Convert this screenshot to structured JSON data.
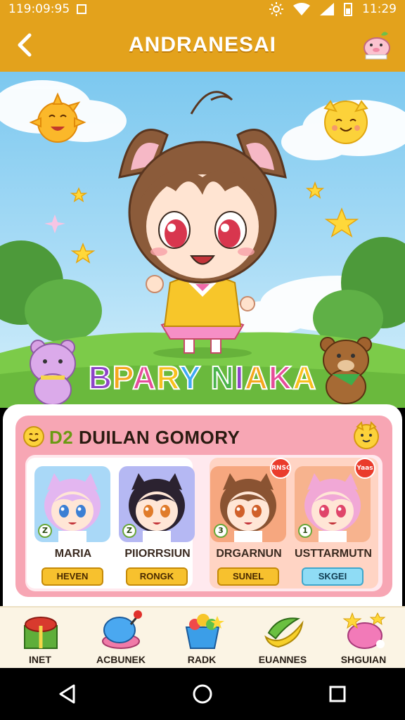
{
  "status_bar": {
    "time_left": "119:09:95",
    "time_right": "11:29"
  },
  "app_bar": {
    "title": "ANDRANESAI"
  },
  "hero": {
    "banner_text": "BPARY NIAKA",
    "banner_colors": [
      "#8e44c8",
      "#f4a81d",
      "#e54d9a",
      "#f7c11e",
      "#3fa9f5",
      "#4bb44b"
    ]
  },
  "party": {
    "level": "D2",
    "title": "DUILAN GOMORY",
    "characters": [
      {
        "name": "MARIA",
        "tag": "HEVEN",
        "level": "Z",
        "badge": "",
        "bg": "#a9d8f7",
        "hair": "#e3b6f0",
        "eyes": "#3b7fd4",
        "tag_style": "gold"
      },
      {
        "name": "PIIORRSIUN",
        "tag": "RONGK",
        "level": "Z",
        "badge": "",
        "bg": "#b5b8f3",
        "hair": "#2b2230",
        "eyes": "#e07b2a",
        "tag_style": "gold"
      },
      {
        "name": "DRGARNUN",
        "tag": "SUNEL",
        "level": "3",
        "badge": "RNSG",
        "bg": "#f6a77f",
        "hair": "#8a5332",
        "eyes": "#d0602a",
        "tag_style": "gold"
      },
      {
        "name": "USTTARMUTN",
        "tag": "SKGEI",
        "level": "1",
        "badge": "Yaas",
        "bg": "#f7b38e",
        "hair": "#f1a8d6",
        "eyes": "#e0456a",
        "tag_style": "blue"
      }
    ]
  },
  "bottom_nav": [
    {
      "label": "INET",
      "icon": "gift-basket-icon"
    },
    {
      "label": "ACBUNEK",
      "icon": "joystick-icon"
    },
    {
      "label": "RADK",
      "icon": "candy-box-icon"
    },
    {
      "label": "EUANNES",
      "icon": "banana-icon"
    },
    {
      "label": "SHGUIAN",
      "icon": "star-pouch-icon"
    }
  ]
}
